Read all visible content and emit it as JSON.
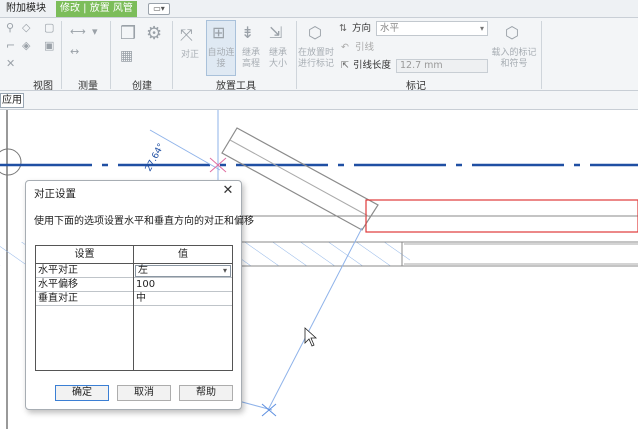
{
  "tabs": [
    {
      "label": "附加模块"
    },
    {
      "label": "修改 | 放置 风管"
    }
  ],
  "ribbon": {
    "panels": [
      "视图",
      "测量",
      "创建",
      "放置工具",
      "标记"
    ],
    "place_tools": {
      "align": "对正",
      "auto_connect": "自动连接",
      "inherit_elevation": "继承高程",
      "inherit_size": "继承大小"
    },
    "tag": {
      "tag_on_place": "在放置时进行标记",
      "orientation_label": "方向",
      "orientation_value": "水平",
      "leader_label": "引线",
      "leader_length_label": "引线长度",
      "leader_length_value": "12.7 mm",
      "load_tags": "载入的标记和符号"
    }
  },
  "apply": "应用",
  "canvas": {
    "angle_label": "27.64°"
  },
  "dialog": {
    "title": "对正设置",
    "description": "使用下面的选项设置水平和垂直方向的对正和偏移",
    "col_setting": "设置",
    "col_value": "值",
    "rows": [
      {
        "name": "水平对正",
        "value": "左"
      },
      {
        "name": "水平偏移",
        "value": "100"
      },
      {
        "name": "垂直对正",
        "value": "中"
      }
    ],
    "ok": "确定",
    "cancel": "取消",
    "help": "帮助"
  }
}
